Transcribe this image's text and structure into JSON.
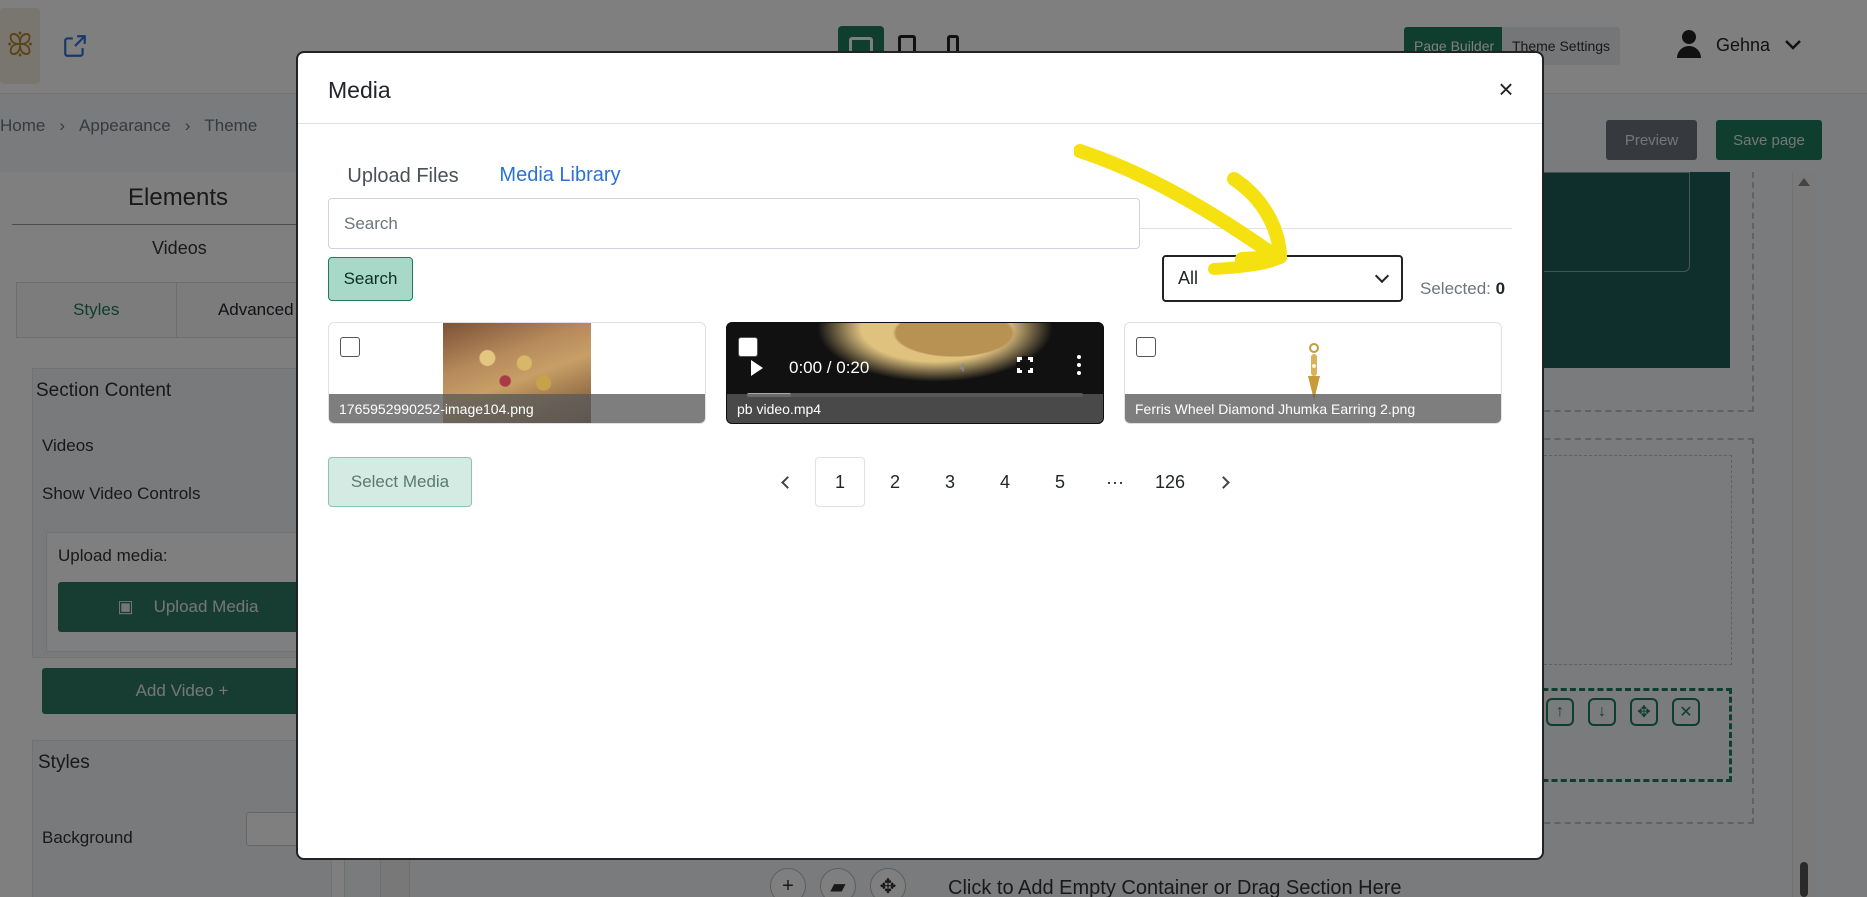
{
  "app": {
    "page_builder_label": "Page Builder",
    "theme_settings_label": "Theme Settings",
    "user_name": "Gehna",
    "breadcrumb": [
      "Home",
      "Appearance",
      "Theme"
    ],
    "preview_label": "Preview",
    "save_label": "Save page",
    "sidebar": {
      "title": "Elements",
      "subtitle": "Videos",
      "tabs": [
        "Styles",
        "Advanced"
      ],
      "section_content": "Section Content",
      "videos_label": "Videos",
      "show_controls_label": "Show Video Controls",
      "upload_media_label": "Upload media:",
      "upload_media_button": "Upload Media",
      "add_video_button": "Add Video +",
      "styles_heading": "Styles",
      "background_label": "Background"
    },
    "canvas_bottom_text": "Click to Add Empty Container or Drag Section Here"
  },
  "modal": {
    "title": "Media",
    "close_glyph": "×",
    "tabs": {
      "upload": "Upload Files",
      "library": "Media Library"
    },
    "search": {
      "placeholder": "Search",
      "value": "",
      "button": "Search"
    },
    "filter": {
      "selected": "All"
    },
    "selected_label": "Selected:",
    "selected_count": "0",
    "items": [
      {
        "name": "1765952990252-image104.png",
        "type": "image"
      },
      {
        "name": "pb video.mp4",
        "type": "video",
        "time": "0:00 / 0:20",
        "progress": 0.13
      },
      {
        "name": "Ferris Wheel Diamond Jhumka Earring 2.png",
        "type": "image"
      }
    ],
    "select_media_button": "Select Media",
    "pagination": {
      "pages": [
        "1",
        "2",
        "3",
        "4",
        "5"
      ],
      "ellipsis": "···",
      "last": "126",
      "current": "1"
    }
  },
  "colors": {
    "brand_green": "#1f7a5c",
    "link_blue": "#2b72d6",
    "annotation_yellow": "#f5e10f"
  }
}
